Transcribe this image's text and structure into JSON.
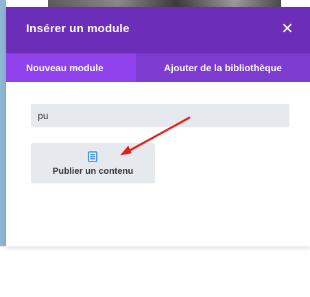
{
  "modal": {
    "title": "Insérer un module",
    "close_glyph": "✕",
    "tabs": [
      {
        "label": "Nouveau module",
        "active": true
      },
      {
        "label": "Ajouter de la bibliothèque",
        "active": false
      }
    ],
    "search": {
      "value": "pu",
      "placeholder": ""
    },
    "modules": [
      {
        "label": "Publier un contenu",
        "icon": "post-content-icon"
      }
    ]
  },
  "colors": {
    "header": "#6c2eb9",
    "tab_bar": "#7e3bd0",
    "active_tab": "#8f42ec",
    "field_bg": "#e6eaee",
    "icon_blue": "#2b87da",
    "annotation_arrow": "#e0201c"
  }
}
